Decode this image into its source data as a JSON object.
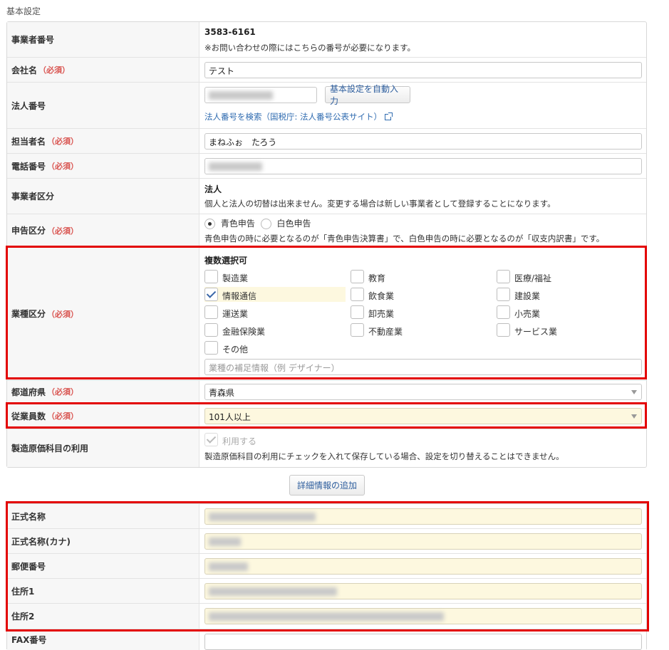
{
  "section_title": "基本設定",
  "required_mark": "（必須）",
  "business_number": {
    "label": "事業者番号",
    "value": "3583-6161",
    "note": "※お問い合わせの際にはこちらの番号が必要になります。"
  },
  "company_name": {
    "label": "会社名",
    "value": "テスト"
  },
  "corporate_number": {
    "label": "法人番号",
    "auto_button": "基本設定を自動入力",
    "search_link": "法人番号を検索（国税庁: 法人番号公表サイト）"
  },
  "contact_name": {
    "label": "担当者名",
    "value": "まねふぉ　たろう"
  },
  "phone": {
    "label": "電話番号"
  },
  "business_type": {
    "label": "事業者区分",
    "value": "法人",
    "note": "個人と法人の切替は出来ません。変更する場合は新しい事業者として登録することになります。"
  },
  "filing": {
    "label": "申告区分",
    "options": [
      "青色申告",
      "白色申告"
    ],
    "selected": "青色申告",
    "note": "青色申告の時に必要となるのが「青色申告決算書」で、白色申告の時に必要となるのが「収支内訳書」です。"
  },
  "industry": {
    "label": "業種区分",
    "heading": "複数選択可",
    "options": [
      {
        "label": "製造業",
        "checked": false
      },
      {
        "label": "教育",
        "checked": false
      },
      {
        "label": "医療/福祉",
        "checked": false
      },
      {
        "label": "情報通信",
        "checked": true
      },
      {
        "label": "飲食業",
        "checked": false
      },
      {
        "label": "建設業",
        "checked": false
      },
      {
        "label": "運送業",
        "checked": false
      },
      {
        "label": "卸売業",
        "checked": false
      },
      {
        "label": "小売業",
        "checked": false
      },
      {
        "label": "金融保険業",
        "checked": false
      },
      {
        "label": "不動産業",
        "checked": false
      },
      {
        "label": "サービス業",
        "checked": false
      },
      {
        "label": "その他",
        "checked": false
      }
    ],
    "supplement_placeholder": "業種の補足情報（例 デザイナー）"
  },
  "prefecture": {
    "label": "都道府県",
    "value": "青森県"
  },
  "employees": {
    "label": "従業員数",
    "value": "101人以上"
  },
  "cost_accounts": {
    "label": "製造原価科目の利用",
    "checkbox_label": "利用する",
    "checked": true,
    "note": "製造原価科目の利用にチェックを入れて保存している場合、設定を切り替えることはできません。"
  },
  "detail_button": "詳細情報の追加",
  "details": {
    "official_name": {
      "label": "正式名称"
    },
    "official_name_kana": {
      "label": "正式名称(カナ)"
    },
    "postal_code": {
      "label": "郵便番号"
    },
    "address1": {
      "label": "住所1"
    },
    "address2": {
      "label": "住所2"
    },
    "fax": {
      "label": "FAX番号"
    }
  },
  "colors": {
    "required": "#d9534f",
    "highlight_box": "#e30000",
    "link": "#2f6bb0",
    "input_yellow": "#fdf8df"
  }
}
